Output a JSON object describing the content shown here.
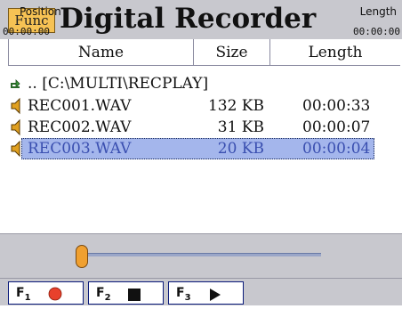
{
  "header": {
    "func_label": "Func",
    "title": "Digital Recorder"
  },
  "columns": {
    "name": "Name",
    "size": "Size",
    "length": "Length"
  },
  "parent_dir": {
    "label": ".. [C:\\MULTI\\RECPLAY]",
    "icon": "folder-up-icon"
  },
  "files": [
    {
      "name": "REC001.WAV",
      "size": "132 KB",
      "length": "00:00:33",
      "icon": "sound-file-icon"
    },
    {
      "name": "REC002.WAV",
      "size": "31 KB",
      "length": "00:00:07",
      "icon": "sound-file-icon"
    },
    {
      "name": "REC003.WAV",
      "size": "20 KB",
      "length": "00:00:04",
      "icon": "sound-file-icon",
      "selected": true
    }
  ],
  "playback": {
    "position_label": "Position",
    "length_label": "Length",
    "position_time": "00:00:00",
    "length_time": "00:00:00",
    "position_fraction": 0.0
  },
  "function_keys": [
    {
      "key": "F1",
      "action": "record",
      "icon": "record-icon"
    },
    {
      "key": "F2",
      "action": "stop",
      "icon": "stop-icon"
    },
    {
      "key": "F3",
      "action": "play",
      "icon": "play-icon"
    }
  ],
  "colors": {
    "title_bar": "#c8c8ce",
    "func_button": "#f6c254",
    "selection": "#a4b6ec",
    "record": "#e8412c",
    "file_icon": "#e0a020"
  }
}
